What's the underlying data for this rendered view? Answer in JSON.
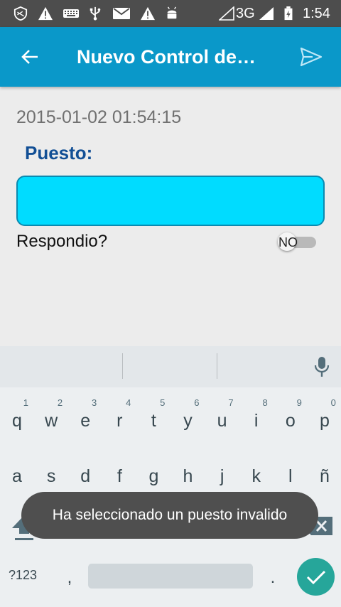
{
  "status_bar": {
    "network": "3G",
    "time": "1:54"
  },
  "app_bar": {
    "title": "Nuevo Control de…"
  },
  "form": {
    "timestamp": "2015-01-02 01:54:15",
    "puesto_label": "Puesto:",
    "puesto_value": "",
    "respondio_label": "Respondio?",
    "respondio_switch": "NO"
  },
  "keyboard": {
    "row1": [
      {
        "letter": "q",
        "hint": "1"
      },
      {
        "letter": "w",
        "hint": "2"
      },
      {
        "letter": "e",
        "hint": "3"
      },
      {
        "letter": "r",
        "hint": "4"
      },
      {
        "letter": "t",
        "hint": "5"
      },
      {
        "letter": "y",
        "hint": "6"
      },
      {
        "letter": "u",
        "hint": "7"
      },
      {
        "letter": "i",
        "hint": "8"
      },
      {
        "letter": "o",
        "hint": "9"
      },
      {
        "letter": "p",
        "hint": "0"
      }
    ],
    "row2": [
      "a",
      "s",
      "d",
      "f",
      "g",
      "h",
      "j",
      "k",
      "l",
      "ñ"
    ],
    "row3": [
      "z",
      "x",
      "c",
      "v",
      "b",
      "n",
      "m"
    ],
    "symbols_label": "?123",
    "comma": ",",
    "period": "."
  },
  "toast": {
    "message": "Ha seleccionado un puesto invalido"
  },
  "colors": {
    "status_bar": "#4d4d4d",
    "app_bar": "#0a98c9",
    "input_fill": "#00dcff",
    "label_accent": "#124f95",
    "enter_key": "#26a69a"
  },
  "icons": [
    "shield-icon",
    "warning-icon",
    "keyboard-icon",
    "usb-icon",
    "mail-icon",
    "android-icon",
    "signal-icon",
    "battery-icon",
    "arrow-back-icon",
    "send-icon",
    "mic-icon",
    "shift-icon",
    "backspace-icon",
    "check-icon"
  ]
}
